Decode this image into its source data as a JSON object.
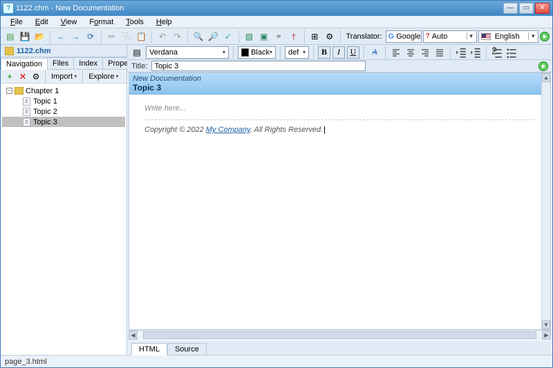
{
  "titlebar": {
    "icon": "?",
    "text": "1122.chm - New Documentation"
  },
  "menus": {
    "file": "File",
    "edit": "Edit",
    "view": "View",
    "format": "Format",
    "tools": "Tools",
    "help": "Help"
  },
  "translator": {
    "label": "Translator:",
    "provider": "Google",
    "from": "Auto",
    "to": "English"
  },
  "project_tab": "1122.chm",
  "nav_tabs": {
    "navigation": "Navigation",
    "files": "Files",
    "index": "Index",
    "properties": "Properties"
  },
  "side_dd": {
    "import": "Import",
    "explore": "Explore"
  },
  "tree": {
    "chapter": "Chapter 1",
    "topics": [
      "Topic 1",
      "Topic 2",
      "Topic 3"
    ]
  },
  "format_bar": {
    "font": "Verdana",
    "color": "Black",
    "size": "def",
    "b": "B",
    "i": "I",
    "u": "U"
  },
  "title_row": {
    "label": "Title:",
    "value": "Topic 3"
  },
  "editor": {
    "breadcrumb": "New Documentation",
    "heading": "Topic 3",
    "placeholder": "Write here...",
    "copy_prefix": "Copyright © 2022 ",
    "copy_link": "My Company",
    "copy_suffix": ". All Rights Reserved."
  },
  "bottom_tabs": {
    "html": "HTML",
    "source": "Source"
  },
  "status": "page_3.html"
}
